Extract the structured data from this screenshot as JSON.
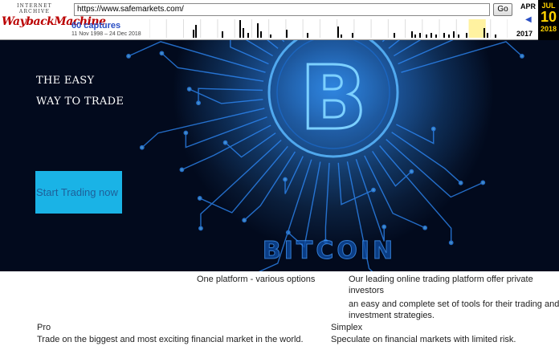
{
  "wayback": {
    "logo_top": "INTERNET ARCHIVE",
    "logo_main": "WaybackMachine",
    "url": "https://www.safemarkets.com/",
    "go_label": "Go",
    "captures": "60 captures",
    "range": "11 Nov 1998 – 24 Dec 2018",
    "prev_month": "APR",
    "prev_year": "2017",
    "cur_month": "JUL",
    "cur_day": "10",
    "cur_year": "2018",
    "arrow": "◀"
  },
  "hero": {
    "line1": "THE EASY",
    "line2": "WAY TO TRADE",
    "cta_label": "Start Trading now",
    "art_word": "BITCOIN",
    "art_symbol": "B"
  },
  "content": {
    "tagline": "One platform - various options",
    "description": [
      "Our leading online trading platform offer private",
      "investors",
      "an easy and complete set of tools for their trading and",
      "investment strategies."
    ],
    "pro": {
      "title": "Pro",
      "text": "Trade on the biggest and most exciting financial market in the world."
    },
    "simplex": {
      "title": "Simplex",
      "text": "Speculate on financial markets with limited risk."
    }
  }
}
